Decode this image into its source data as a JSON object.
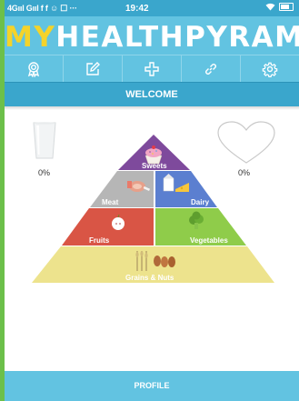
{
  "status_bar": {
    "left": "4Gııl Gııl f f ☺ ☐ ···",
    "time": "19:42"
  },
  "app": {
    "logo_my": "MY",
    "logo_health": "HEALTH",
    "logo_pyramid": "PYRAMID"
  },
  "tabs": [
    {
      "name": "achievements",
      "icon": "medal-icon"
    },
    {
      "name": "edit",
      "icon": "pencil-square-icon"
    },
    {
      "name": "add",
      "icon": "plus-icon"
    },
    {
      "name": "link",
      "icon": "link-icon"
    },
    {
      "name": "settings",
      "icon": "gear-icon"
    }
  ],
  "welcome": "WELCOME",
  "water": {
    "percent": "0%"
  },
  "heart": {
    "percent": "0%"
  },
  "pyramid": {
    "sweets": "Sweets",
    "meat": "Meat",
    "dairy": "Dairy",
    "fruits": "Fruits",
    "vegetables": "Vegetables",
    "grains": "Grains & Nuts"
  },
  "colors": {
    "sweets": "#7e4a9c",
    "meat": "#b6b6b6",
    "dairy": "#5b7fd0",
    "fruits": "#d95545",
    "vegetables": "#8fcc4a",
    "grains": "#ede38d",
    "header": "#62c3e1",
    "accent_yellow": "#f4d32a"
  },
  "profile": "PROFILE"
}
